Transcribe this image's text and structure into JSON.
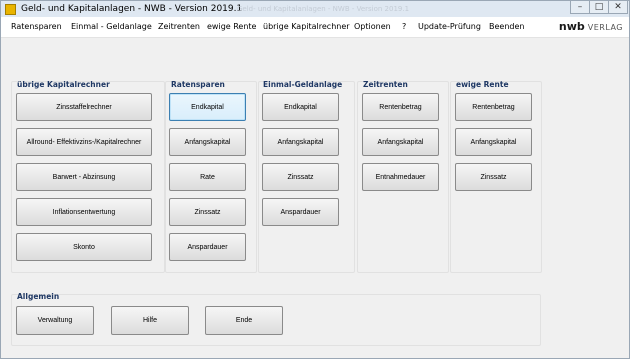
{
  "window": {
    "title": "Geld- und Kapitalanlagen - NWB - Version 2019.1",
    "title_ghost": "Geld- und Kapitalanlagen - NWB - Version 2019.1",
    "minimize_glyph": "–",
    "maximize_glyph": "□",
    "close_glyph": "✕"
  },
  "menu": [
    "Ratensparen",
    "Einmal - Geldanlage",
    "Zeitrenten",
    "ewige Rente",
    "übrige Kapitalrechner",
    "Optionen",
    "?",
    "Update-Prüfung",
    "Beenden"
  ],
  "logo": {
    "main": "nwb",
    "sub": "VERLAG"
  },
  "groups": {
    "uebrige": {
      "title": "übrige Kapitalrechner",
      "buttons": [
        "Zinsstaffelrechner",
        "Allround- Effektivzins-/Kapitalrechner",
        "Barwert - Abzinsung",
        "Inflationsentwertung",
        "Skonto"
      ]
    },
    "ratensparen": {
      "title": "Ratensparen",
      "buttons": [
        "Endkapital",
        "Anfangskapital",
        "Rate",
        "Zinssatz",
        "Anspardauer"
      ]
    },
    "einmal": {
      "title": "Einmal-Geldanlage",
      "buttons": [
        "Endkapital",
        "Anfangskapital",
        "Zinssatz",
        "Anspardauer"
      ]
    },
    "zeitrenten": {
      "title": "Zeitrenten",
      "buttons": [
        "Rentenbetrag",
        "Anfangskapital",
        "Entnahmedauer"
      ]
    },
    "ewige": {
      "title": "ewige Rente",
      "buttons": [
        "Rentenbetrag",
        "Anfangskapital",
        "Zinssatz"
      ]
    },
    "allgemein": {
      "title": "Allgemein",
      "buttons": [
        "Verwaltung",
        "Hilfe",
        "Ende"
      ]
    }
  },
  "colors": {
    "group_title": "#1f3864",
    "active_button_border": "#3c7fb1"
  }
}
